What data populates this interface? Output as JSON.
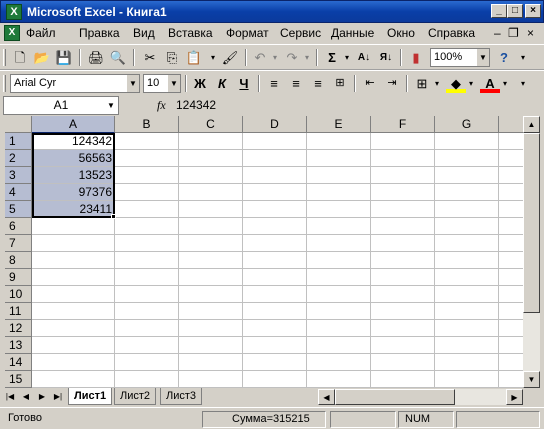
{
  "title_bar": {
    "title": "Microsoft Excel - Книга1",
    "icon": "excel-icon",
    "buttons": {
      "minimize": "_",
      "maximize": "□",
      "close": "×"
    }
  },
  "menu": {
    "items": [
      "Файл",
      "Правка",
      "Вид",
      "Вставка",
      "Формат",
      "Сервис",
      "Данные",
      "Окно",
      "Справка"
    ],
    "right": {
      "minimize": "–",
      "restore": "❐",
      "close": "×"
    }
  },
  "standard_toolbar": {
    "zoom": "100%",
    "icons": [
      "new-icon",
      "open-icon",
      "save-icon",
      "print-icon",
      "print-preview-icon",
      "cut-icon",
      "copy-icon",
      "paste-icon",
      "format-painter-icon",
      "undo-icon",
      "redo-icon",
      "autosum-icon",
      "sort-ascending-icon",
      "sort-descending-icon",
      "chart-wizard-icon",
      "help-icon"
    ],
    "glyphs": {
      "new": "🗋",
      "open": "📂",
      "save": "💾",
      "print": "🖨",
      "preview": "🔍",
      "cut": "✂",
      "copy": "⎘",
      "paste": "📋",
      "painter": "🖌",
      "undo": "↶",
      "redo": "↷",
      "sum": "Σ",
      "sort_az": "A↓",
      "sort_za": "Я↓",
      "chart": "▮",
      "help": "?"
    }
  },
  "formatting_toolbar": {
    "font": "Arial Cyr",
    "size": "10",
    "bold": "Ж",
    "italic": "К",
    "underline": "Ч",
    "icons": [
      "align-left-icon",
      "align-center-icon",
      "align-right-icon",
      "merge-center-icon",
      "decrease-indent-icon",
      "increase-indent-icon",
      "borders-icon",
      "fill-color-icon",
      "font-color-icon"
    ],
    "font_color_label": "A",
    "fill_color": "#ffff00",
    "font_color": "#ff0000"
  },
  "formula_bar": {
    "name_box": "A1",
    "fx": "fx",
    "formula": "124342"
  },
  "grid": {
    "columns": [
      "A",
      "B",
      "C",
      "D",
      "E",
      "F",
      "G"
    ],
    "rows": [
      "1",
      "2",
      "3",
      "4",
      "5",
      "6",
      "7",
      "8",
      "9",
      "10",
      "11",
      "12",
      "13",
      "14",
      "15"
    ],
    "column_a_values": [
      "124342",
      "56563",
      "13523",
      "97376",
      "23411"
    ],
    "selection_color": "#b6bdd2"
  },
  "sheet_tabs": [
    "Лист1",
    "Лист2",
    "Лист3"
  ],
  "status_bar": {
    "ready": "Готово",
    "sum": "Сумма=315215",
    "num": "NUM"
  }
}
